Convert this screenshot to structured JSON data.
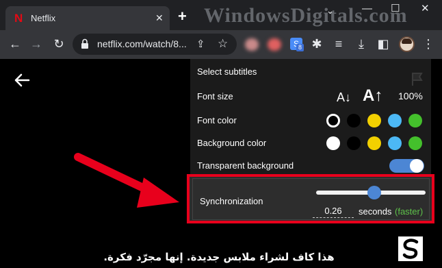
{
  "browser": {
    "tab_title": "Netflix",
    "url": "netflix.com/watch/8...",
    "watermark": "WindowsDigitals.com",
    "extension_badge_count": "8"
  },
  "subtitles_panel": {
    "header": "Select subtitles",
    "font_size": {
      "label": "Font size",
      "small_glyph": "A↓",
      "large_glyph": "A↑",
      "value": "100%"
    },
    "font_color": {
      "label": "Font color",
      "swatches": [
        "#000000",
        "#000000",
        "#f2d000",
        "#4cb8f5",
        "#44c02c"
      ],
      "selected_index": 0
    },
    "background_color": {
      "label": "Background color",
      "swatches": [
        "#ffffff",
        "#000000",
        "#f2d000",
        "#4cb8f5",
        "#44c02c"
      ]
    },
    "transparent_background": {
      "label": "Transparent background",
      "on": true
    },
    "synchronization": {
      "label": "Synchronization",
      "value": "0.26",
      "units": "seconds",
      "hint": "(faster)",
      "slider_fraction": 0.55
    }
  },
  "subtitle_text": "هذا كاف لشراء ملابس جديدة. إنها مجرّد فكرة.",
  "colors": {
    "highlight": "#e8001c",
    "accent": "#4c86d4",
    "hint_green": "#5ec24a"
  }
}
